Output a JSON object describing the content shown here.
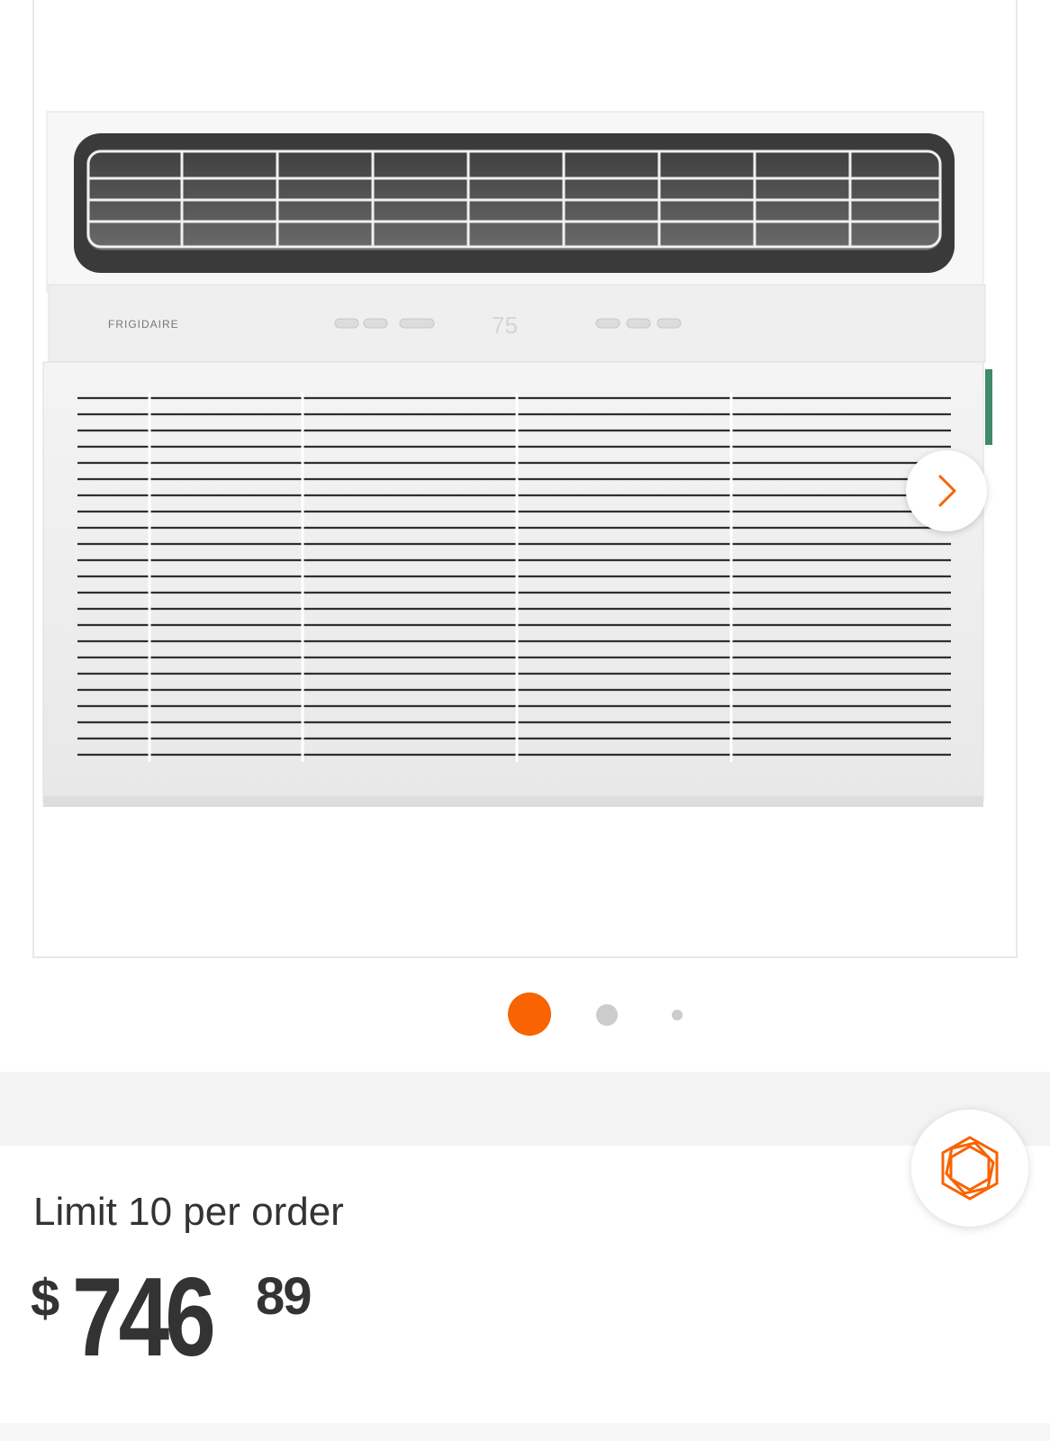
{
  "gallery": {
    "image_alt": "Frigidaire window air conditioner",
    "brand_label": "FRIGIDAIRE",
    "next_icon": "chevron-right-icon",
    "dots": [
      {
        "state": "active"
      },
      {
        "state": "inactive"
      },
      {
        "state": "inactive"
      }
    ],
    "active_index": 0,
    "accent_color": "#f96302"
  },
  "badge": {
    "icon": "hexagon-badge-icon",
    "color": "#f96302"
  },
  "purchase": {
    "limit_text": "Limit 10 per order",
    "price_currency": "$",
    "price_dollars": "746",
    "price_cents": "89"
  }
}
